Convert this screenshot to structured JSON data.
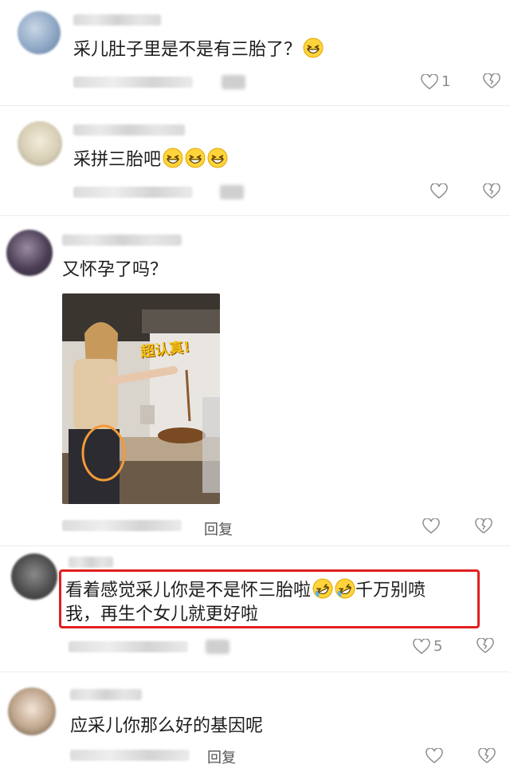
{
  "comments": [
    {
      "text": "采儿肚子里是不是有三胎了？",
      "emoji_count": 1,
      "emoji": "grinning-squint-emoji",
      "like_count": "1"
    },
    {
      "text": "采拼三胎吧",
      "emoji_count": 3,
      "emoji": "grinning-squint-emoji",
      "like_count": ""
    },
    {
      "text": "又怀孕了吗？",
      "like_count": "",
      "reply_label": "回复",
      "photo_caption": "超认真!"
    },
    {
      "text_line1": "看着感觉采儿你是不是怀三胎啦",
      "emoji": "rofl-emoji",
      "text_line1b": "千万别喷",
      "text_line2": "我，再生个女儿就更好啦",
      "like_count": "5"
    },
    {
      "text": "应采儿你那么好的基因呢",
      "like_count": "",
      "reply_label": "回复"
    }
  ],
  "colors": {
    "highlight": "#e0201f",
    "icon": "#8a8a8a",
    "text": "#1d1d1d"
  }
}
